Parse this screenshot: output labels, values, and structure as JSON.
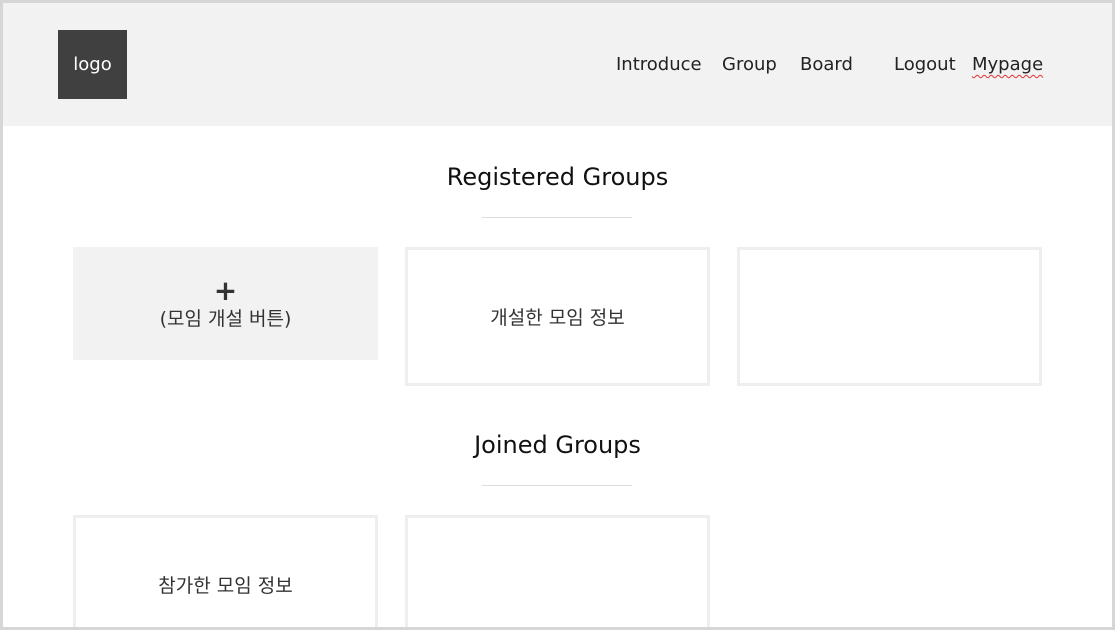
{
  "header": {
    "logo_text": "logo",
    "nav": {
      "introduce": "Introduce",
      "group": "Group",
      "board": "Board",
      "logout": "Logout",
      "mypage": "Mypage"
    }
  },
  "registered": {
    "title": "Registered Groups",
    "add_button": {
      "icon": "+",
      "label": "(모임 개설 버튼)"
    },
    "cards": [
      "개설한 모임 정보",
      ""
    ]
  },
  "joined": {
    "title": "Joined Groups",
    "cards": [
      "참가한 모임 정보",
      ""
    ]
  },
  "colors": {
    "header_bg": "#f2f2f2",
    "logo_bg": "#404040",
    "card_border": "#eeeeee",
    "frame_border": "#d6d6d6"
  }
}
